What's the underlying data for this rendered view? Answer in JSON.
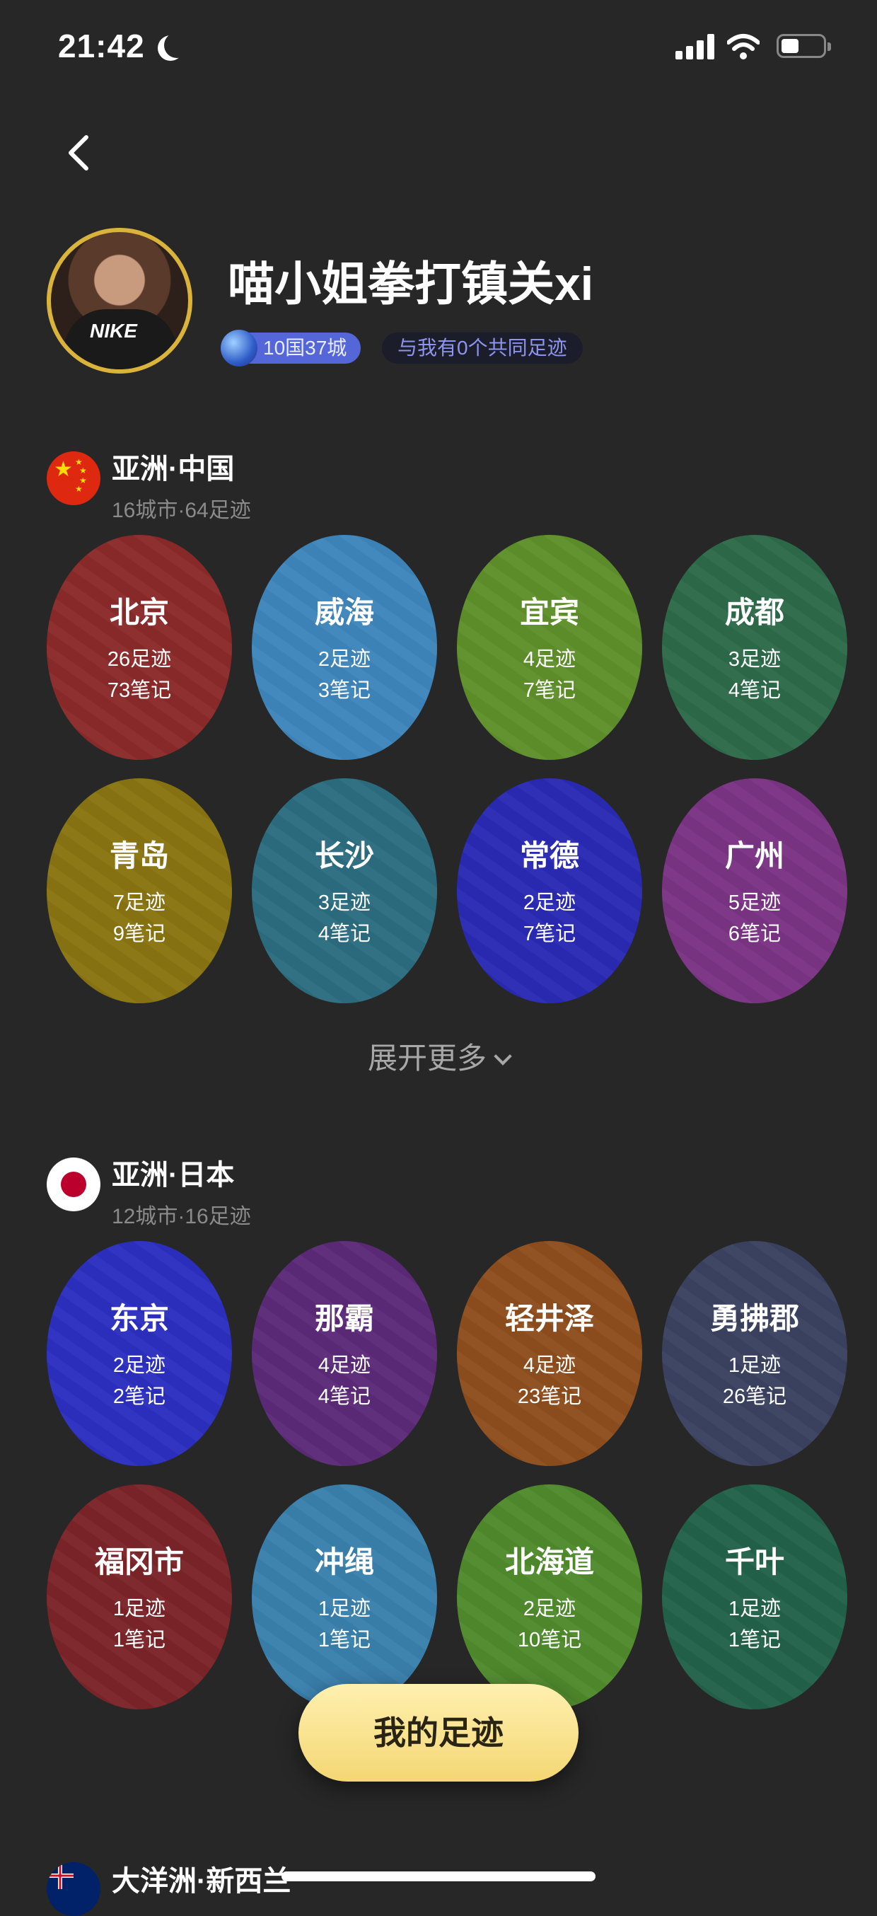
{
  "status_bar": {
    "time": "21:42"
  },
  "profile": {
    "name": "喵小姐拳打镇关xi",
    "badge_cities": "10国37城",
    "badge_common": "与我有0个共同足迹"
  },
  "sections": [
    {
      "title": "亚洲·中国",
      "subtitle": "16城市·64足迹",
      "cities": [
        {
          "name": "北京",
          "footprints": "26足迹",
          "notes": "73笔记",
          "color": "#8c2a2a"
        },
        {
          "name": "威海",
          "footprints": "2足迹",
          "notes": "3笔记",
          "color": "#3e86bb"
        },
        {
          "name": "宜宾",
          "footprints": "4足迹",
          "notes": "7笔记",
          "color": "#5f8f2a"
        },
        {
          "name": "成都",
          "footprints": "3足迹",
          "notes": "4笔记",
          "color": "#2d6b4a"
        },
        {
          "name": "青岛",
          "footprints": "7足迹",
          "notes": "9笔记",
          "color": "#8a7412"
        },
        {
          "name": "长沙",
          "footprints": "3足迹",
          "notes": "4笔记",
          "color": "#2c6c80"
        },
        {
          "name": "常德",
          "footprints": "2足迹",
          "notes": "7笔记",
          "color": "#2a2ab4"
        },
        {
          "name": "广州",
          "footprints": "5足迹",
          "notes": "6笔记",
          "color": "#7a3384"
        }
      ],
      "expand_label": "展开更多"
    },
    {
      "title": "亚洲·日本",
      "subtitle": "12城市·16足迹",
      "cities": [
        {
          "name": "东京",
          "footprints": "2足迹",
          "notes": "2笔记",
          "color": "#2b2fc0"
        },
        {
          "name": "那霸",
          "footprints": "4足迹",
          "notes": "4笔记",
          "color": "#5b2a78"
        },
        {
          "name": "轻井泽",
          "footprints": "4足迹",
          "notes": "23笔记",
          "color": "#8f4e1e"
        },
        {
          "name": "勇拂郡",
          "footprints": "1足迹",
          "notes": "26笔记",
          "color": "#3b4260"
        },
        {
          "name": "福冈市",
          "footprints": "1足迹",
          "notes": "1笔记",
          "color": "#7a2428"
        },
        {
          "name": "冲绳",
          "footprints": "1足迹",
          "notes": "1笔记",
          "color": "#3a80ad"
        },
        {
          "name": "北海道",
          "footprints": "2足迹",
          "notes": "10笔记",
          "color": "#4f8a2c"
        },
        {
          "name": "千叶",
          "footprints": "1足迹",
          "notes": "1笔记",
          "color": "#23624a"
        }
      ]
    },
    {
      "title": "大洋洲·新西兰"
    }
  ],
  "bottom_button": "我的足迹"
}
